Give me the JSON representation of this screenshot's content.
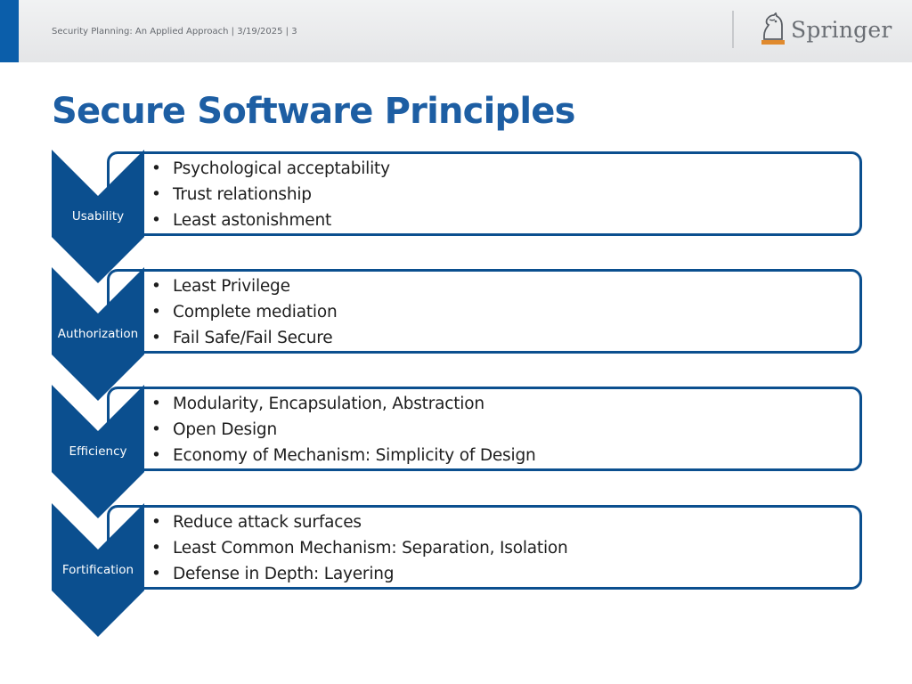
{
  "header": {
    "footer_text": "Security Planning: An Applied Approach | 3/19/2025 | 3",
    "logo_text": "Springer"
  },
  "slide": {
    "title": "Secure Software Principles"
  },
  "groups": [
    {
      "label": "Usability",
      "items": [
        "Psychological acceptability",
        "Trust relationship",
        "Least astonishment"
      ]
    },
    {
      "label": "Authorization",
      "items": [
        "Least Privilege",
        "Complete mediation",
        "Fail Safe/Fail Secure"
      ]
    },
    {
      "label": "Efficiency",
      "items": [
        "Modularity, Encapsulation, Abstraction",
        "Open Design",
        "Economy of Mechanism: Simplicity of Design"
      ]
    },
    {
      "label": "Fortification",
      "items": [
        "Reduce attack surfaces",
        "Least Common Mechanism: Separation, Isolation",
        "Defense in Depth: Layering"
      ]
    }
  ],
  "colors": {
    "chevron": "#0b4f8f",
    "title": "#1d5ea3",
    "accent": "#0b5eaa"
  },
  "icons": [
    "springer-knight-logo-icon"
  ]
}
